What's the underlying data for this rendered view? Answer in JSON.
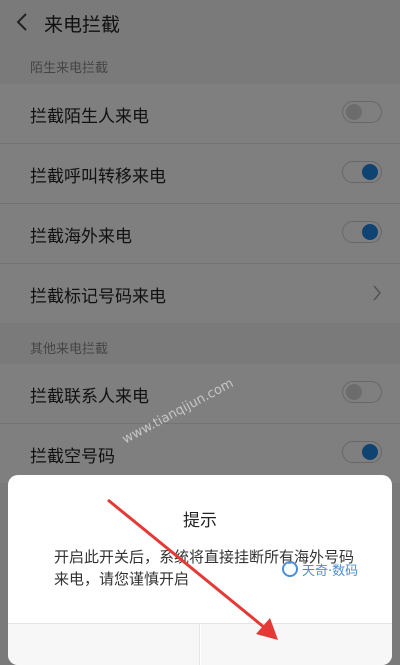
{
  "header": {
    "title": "来电拦截",
    "back_icon": "chevron-left-icon"
  },
  "sections": [
    {
      "title": "陌生来电拦截",
      "items": [
        {
          "label": "拦截陌生人来电",
          "control": "toggle",
          "on": false
        },
        {
          "label": "拦截呼叫转移来电",
          "control": "toggle",
          "on": true
        },
        {
          "label": "拦截海外来电",
          "control": "toggle",
          "on": true
        },
        {
          "label": "拦截标记号码来电",
          "control": "chevron",
          "icon": "chevron-right-icon"
        }
      ]
    },
    {
      "title": "其他来电拦截",
      "items": [
        {
          "label": "拦截联系人来电",
          "control": "toggle",
          "on": false
        },
        {
          "label": "拦截空号码",
          "control": "toggle",
          "on": true
        }
      ]
    }
  ],
  "dialog": {
    "title": "提示",
    "message": "开启此开关后，系统将直接挂断所有海外号码来电，请您谨慎开启"
  },
  "watermark": {
    "url": "www.tianqijun.com",
    "logo_text": "天奇·数码"
  },
  "colors": {
    "accent": "#1e88e5",
    "arrow": "#e53935",
    "background": "#f4f4f4"
  }
}
